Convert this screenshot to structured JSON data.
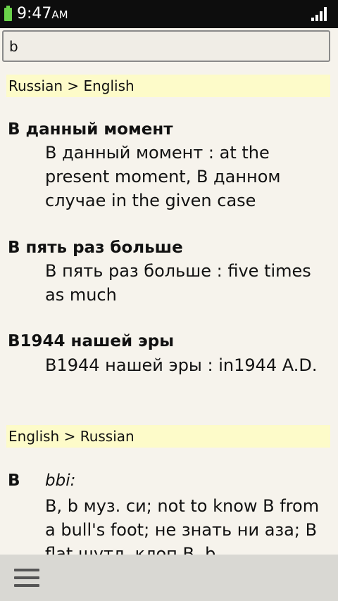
{
  "status_bar": {
    "time": "9:47",
    "ampm": "AM",
    "battery_icon": "battery-icon",
    "signal_icon": "signal-icon",
    "accent_color": "#6ad24a"
  },
  "search": {
    "value": "b"
  },
  "sections": [
    {
      "header": "Russian > English",
      "entries": [
        {
          "title": "В данный момент",
          "definition": "В данный момент : at the present moment, В данном случае in the given case"
        },
        {
          "title": "В пять раз больше",
          "definition": "В пять раз больше : five times as much"
        },
        {
          "title": "В1944 нашей эры",
          "definition": "В1944 нашей эры : in1944 A.D."
        }
      ]
    },
    {
      "header": "English > Russian",
      "entries": [
        {
          "title": "B",
          "label": "bbi:",
          "definition": "B, b муз. си; not to know B from a bull's foot; не знать ни аза; B flat шутл. клоп B, b"
        }
      ]
    }
  ],
  "bottom_bar": {
    "menu_icon": "menu-icon"
  }
}
